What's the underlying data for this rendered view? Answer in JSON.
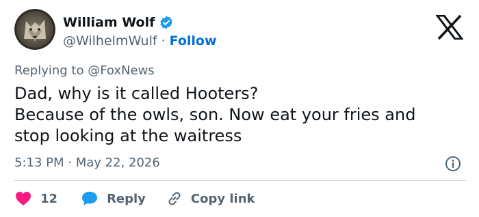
{
  "author": {
    "name": "William Wolf",
    "handle": "@WilhelmWulf",
    "separator": "·",
    "follow_label": "Follow"
  },
  "reply_context": {
    "prefix": "Replying to",
    "mention": "@FoxNews"
  },
  "tweet": {
    "lines": [
      "Dad, why is it called Hooters?",
      "Because of the owls, son. Now eat your fries and",
      "stop looking at the waitress"
    ],
    "time": "5:13 PM",
    "separator": "·",
    "date": "May 22, 2026"
  },
  "actions": {
    "like_count": "12",
    "reply_label": "Reply",
    "copy_link_label": "Copy link"
  },
  "colors": {
    "like": "#f91880",
    "reply": "#1d9bf0",
    "follow": "#006fd6",
    "verified": "#1d9bf0",
    "muted": "#536471"
  },
  "icons": [
    "verified-badge-icon",
    "x-logo-icon",
    "info-icon",
    "heart-icon",
    "reply-bubble-icon",
    "link-icon"
  ]
}
